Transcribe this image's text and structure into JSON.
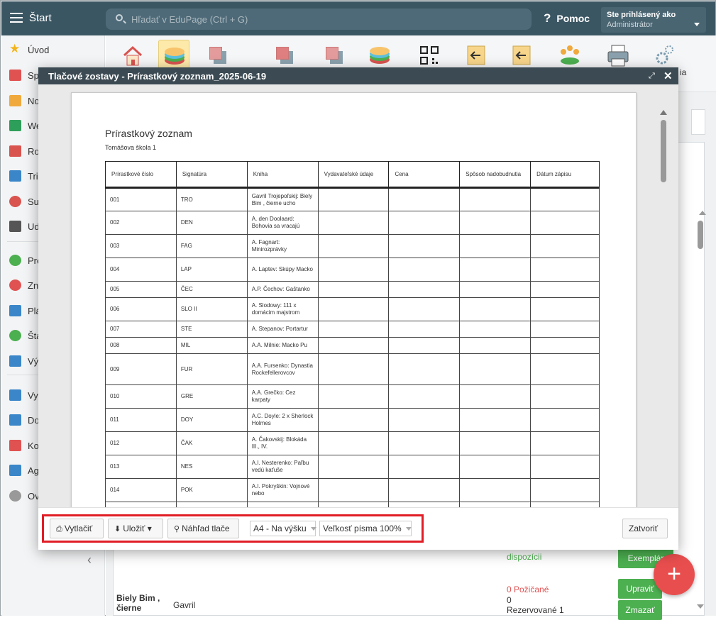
{
  "topbar": {
    "start_label": "Štart",
    "search_placeholder": "Hľadať v EduPage (Ctrl + G)",
    "help_label": "Pomoc",
    "user_line1": "Ste prihlásený ako",
    "user_line2": "Administrátor"
  },
  "sidebar": {
    "items": [
      {
        "label": "Úvod",
        "icon": "star-icon",
        "color": "#f3b41b"
      },
      {
        "label": "Sp",
        "icon": "magic-wand-icon",
        "color": "#e05252"
      },
      {
        "label": "No",
        "icon": "envelope-icon",
        "color": "#f0a93c"
      },
      {
        "label": "We",
        "icon": "home-icon",
        "color": "#2e9e5b"
      },
      {
        "label": "Ro",
        "icon": "calendar-grid-icon",
        "color": "#d9534f"
      },
      {
        "label": "Tri",
        "icon": "book-icon",
        "color": "#3a86c8"
      },
      {
        "label": "Su",
        "icon": "person-icon",
        "color": "#d9534f"
      },
      {
        "label": "Ud",
        "icon": "calendar-icon",
        "color": "#555555"
      },
      {
        "label": "Pre",
        "icon": "check-circle-icon",
        "color": "#4caf50"
      },
      {
        "label": "Zn",
        "icon": "chart-circle-icon",
        "color": "#e05252"
      },
      {
        "label": "Plá",
        "icon": "briefcase-icon",
        "color": "#3a86c8"
      },
      {
        "label": "Šta",
        "icon": "shield-check-icon",
        "color": "#4caf50"
      },
      {
        "label": "Vý",
        "icon": "bar-chart-icon",
        "color": "#3a86c8"
      },
      {
        "label": "Vy",
        "icon": "open-book-icon",
        "color": "#3a86c8"
      },
      {
        "label": "Do",
        "icon": "document-icon",
        "color": "#3a86c8"
      },
      {
        "label": "Ko",
        "icon": "chat-icon",
        "color": "#e05252"
      },
      {
        "label": "Ag",
        "icon": "pen-icon",
        "color": "#3a86c8"
      },
      {
        "label": "Ov",
        "icon": "gear-icon",
        "color": "#999999"
      }
    ]
  },
  "apptool": {
    "cut_label": "ia"
  },
  "background": {
    "status_available": "dispozícii",
    "btn_copies": "Exemplár",
    "book_title": "Biely Bim ,\nčierne",
    "author": "Gavril",
    "status_borrowed": "0 Požičané",
    "status_zero": "0",
    "status_reserved": "Rezervované 1",
    "btn_edit": "Upraviť",
    "btn_delete": "Zmazať",
    "fab": "+"
  },
  "dialog": {
    "title": "Tlačové zostavy - Prírastkový zoznam_2025-06-19",
    "report_title": "Prírastkový zoznam",
    "school": "Tomášova škola 1",
    "columns": [
      "Prírastkové číslo",
      "Signatúra",
      "Kniha",
      "Vydavateľské údaje",
      "Cena",
      "Spôsob nadobudnutia",
      "Dátum zápisu"
    ],
    "rows": [
      {
        "no": "001",
        "sig": "TRO",
        "book": "Gavril Trojepoľskij: Biely Bim , čierne ucho"
      },
      {
        "no": "002",
        "sig": "DEN",
        "book": "A. den Doolaard: Bohovia sa vracajú"
      },
      {
        "no": "003",
        "sig": "FAG",
        "book": "A. Fagnart: Minirozprávky"
      },
      {
        "no": "004",
        "sig": "LAP",
        "book": "A. Laptev: Skúpy Macko"
      },
      {
        "no": "005",
        "sig": "ČEC",
        "book": "A.P. Čechov: Gaštanko"
      },
      {
        "no": "006",
        "sig": "SLO II",
        "book": "A. Slodowy: 111 x domácim majstrom"
      },
      {
        "no": "007",
        "sig": "STE",
        "book": "A. Stepanov: Portartur"
      },
      {
        "no": "008",
        "sig": "MIL",
        "book": "A.A. Milnie: Macko Pu"
      },
      {
        "no": "009",
        "sig": "FUR",
        "book": "A.A. Fursenko: Dynastia Rockefellerovcov"
      },
      {
        "no": "010",
        "sig": "GRE",
        "book": "A.A. Grečko: Cez karpaty"
      },
      {
        "no": "011",
        "sig": "DOY",
        "book": "A.C. Doyle: 2 x Sherlock Holmes"
      },
      {
        "no": "012",
        "sig": "ČAK",
        "book": "A. Čakovskij: Blokáda III., IV."
      },
      {
        "no": "013",
        "sig": "NES",
        "book": "A.I. Nesterenko: Paľbu vedú kaťuše"
      },
      {
        "no": "014",
        "sig": "POK",
        "book": "A.I. Pokryškin: Vojnové nebo"
      },
      {
        "no": "",
        "sig": "",
        "book": ""
      }
    ],
    "footer": {
      "print_label": "Vytlačiť",
      "save_label": "Uložiť ▾",
      "preview_label": "Náhľad tlače",
      "paper_format": "A4 - Na výšku",
      "font_size": "Veľkosť písma 100%",
      "close_label": "Zatvoriť"
    }
  }
}
